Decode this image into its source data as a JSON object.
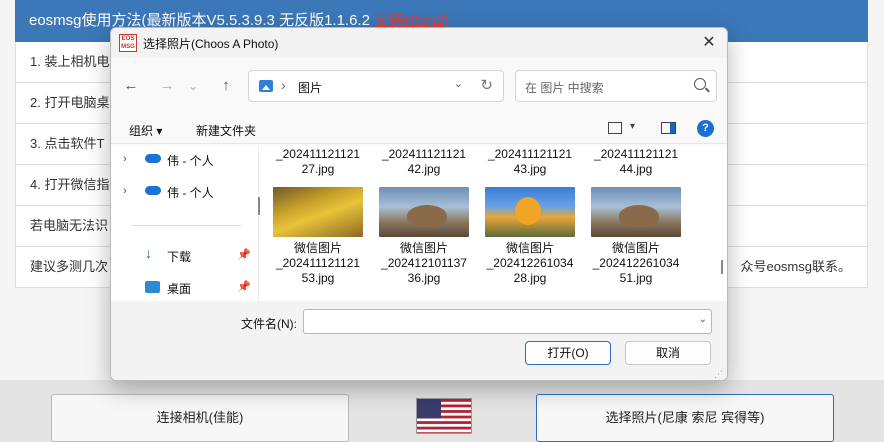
{
  "background_app": {
    "header_text": "eosmsg使用方法(最新版本V5.5.3.9.3 无反版1.1.6.2 ",
    "header_highlight": "支持R5m2)",
    "rows": [
      {
        "text": "1. 装上相机电",
        "tail": ""
      },
      {
        "text": "2. 打开电脑桌",
        "tail": ""
      },
      {
        "text": "3. 点击软件T",
        "tail": ""
      },
      {
        "text": "4. 打开微信指",
        "tail": ""
      },
      {
        "text": "若电脑无法识",
        "tail": ""
      },
      {
        "text": "建议多测几次",
        "tail": "众号eosmsg联系。"
      }
    ],
    "connect_button": "连接相机(佳能)",
    "select_photo_button": "选择照片(尼康 索尼 宾得等)"
  },
  "dialog": {
    "app_icon_text": "EOS MSG",
    "title": "选择照片(Choos A Photo)",
    "close": "✕",
    "nav": {
      "back": "←",
      "forward": "→",
      "dropdown": "⌄",
      "up": "↑"
    },
    "address": {
      "separator": "›",
      "location": "图片",
      "dropdown": "⌄",
      "refresh": "↻"
    },
    "search_placeholder": "在 图片 中搜索",
    "commands": {
      "organize": "组织 ▾",
      "new_folder": "新建文件夹",
      "view_dropdown": "▾",
      "help": "?"
    },
    "sidebar": {
      "items": [
        {
          "label": "伟 - 个人",
          "chevron": "›"
        },
        {
          "label": "伟 - 个人",
          "chevron": "›"
        },
        {
          "label": "下载",
          "pin": "📌"
        },
        {
          "label": "桌面",
          "pin": "📌"
        }
      ],
      "download_icon": "↓"
    },
    "files_top_row": [
      {
        "line1": "_202411121121",
        "line2": "27.jpg"
      },
      {
        "line1": "_202411121121",
        "line2": "42.jpg"
      },
      {
        "line1": "_202411121121",
        "line2": "43.jpg"
      },
      {
        "line1": "_202411121121",
        "line2": "44.jpg"
      }
    ],
    "files": [
      {
        "line1": "微信图片",
        "line2": "_202411121121",
        "line3": "53.jpg",
        "thumb": "tree"
      },
      {
        "line1": "微信图片",
        "line2": "_202412101137",
        "line3": "36.jpg",
        "thumb": "cat"
      },
      {
        "line1": "微信图片",
        "line2": "_202412261034",
        "line3": "28.jpg",
        "thumb": "autumn"
      },
      {
        "line1": "微信图片",
        "line2": "_202412261034",
        "line3": "51.jpg",
        "thumb": "cat"
      }
    ],
    "filename_label": "文件名(N):",
    "filename_value": "",
    "filename_dropdown": "⌄",
    "open_button": "打开(O)",
    "cancel_button": "取消"
  }
}
